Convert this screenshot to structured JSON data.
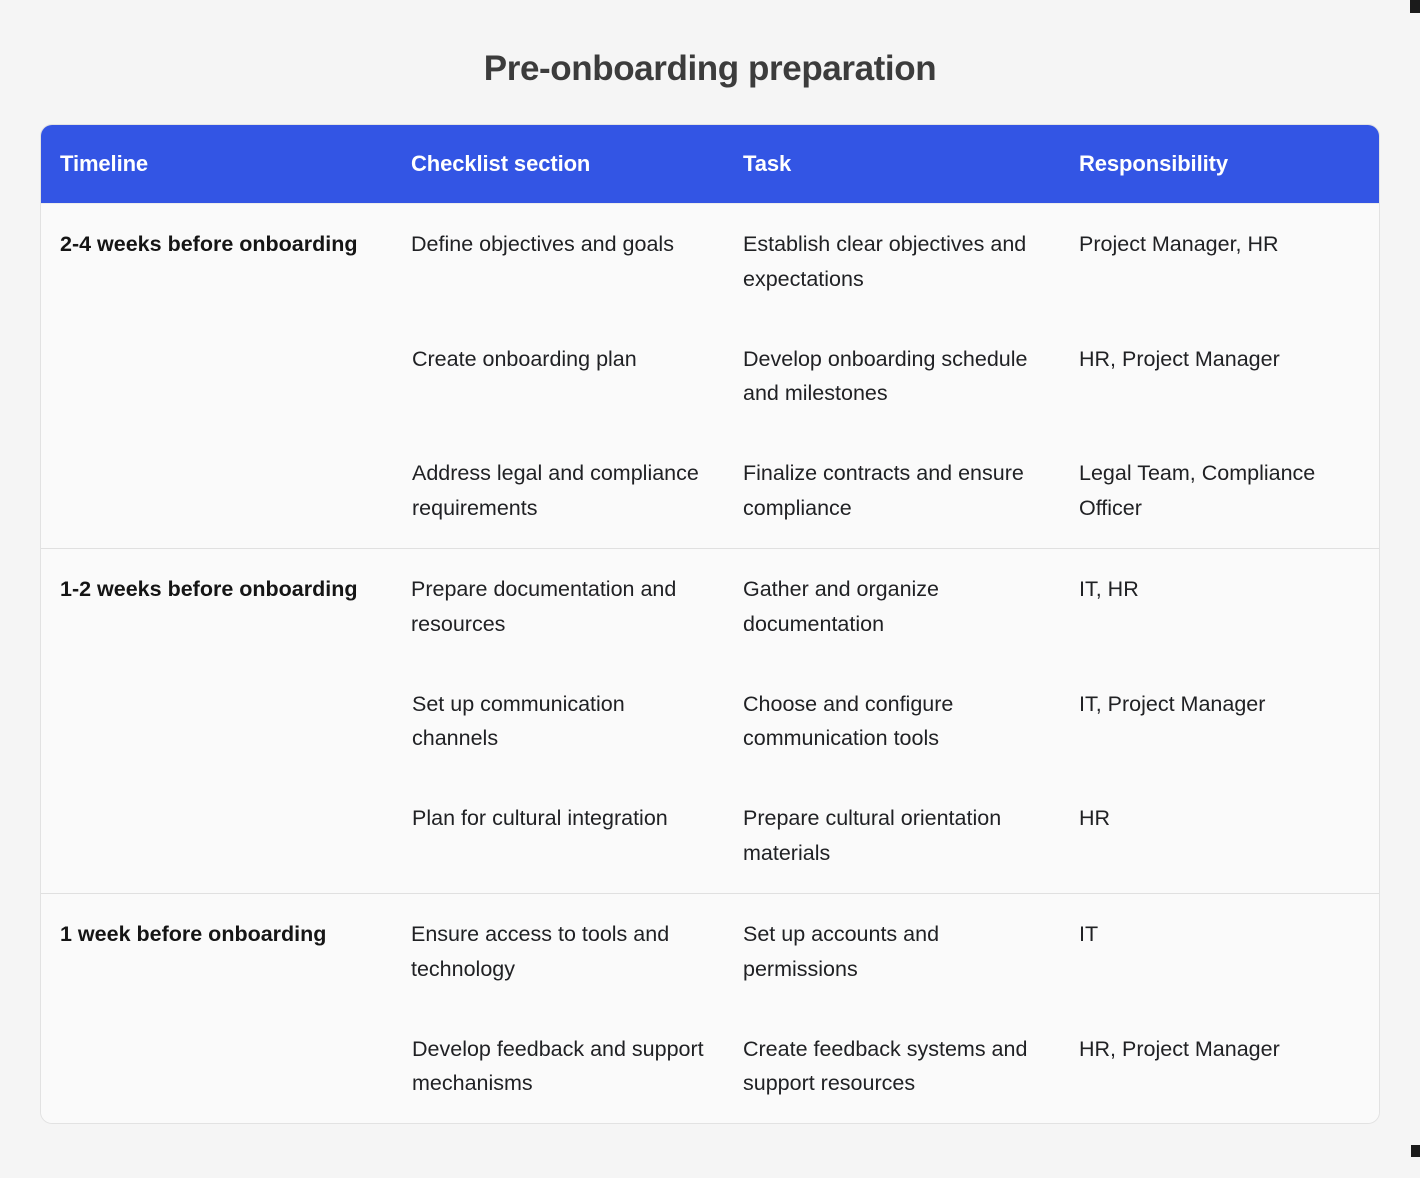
{
  "page": {
    "title": "Pre-onboarding preparation",
    "background_color": "#f5f5f5",
    "accent_color": "#3355e4",
    "card_background": "#fafafa",
    "header_text_color": "#ffffff",
    "body_text_color": "#202124"
  },
  "table": {
    "columns": [
      {
        "key": "timeline",
        "label": "Timeline"
      },
      {
        "key": "checklist",
        "label": "Checklist section"
      },
      {
        "key": "task",
        "label": "Task"
      },
      {
        "key": "responsibility",
        "label": "Responsibility"
      }
    ],
    "groups": [
      {
        "timeline": "2-4 weeks before onboarding",
        "rows": [
          {
            "checklist": "Define objectives and goals",
            "task": "Establish clear objectives and expectations",
            "responsibility": "Project Manager, HR"
          },
          {
            "checklist": "Create onboarding plan",
            "task": "Develop onboarding schedule and milestones",
            "responsibility": "HR, Project Manager"
          },
          {
            "checklist": "Address legal and compliance requirements",
            "task": "Finalize contracts and ensure compliance",
            "responsibility": "Legal Team, Compliance Officer"
          }
        ]
      },
      {
        "timeline": "1-2 weeks before onboarding",
        "rows": [
          {
            "checklist": "Prepare documentation and resources",
            "task": "Gather and organize documentation",
            "responsibility": "IT, HR"
          },
          {
            "checklist": "Set up communication channels",
            "task": "Choose and configure communication tools",
            "responsibility": "IT, Project Manager"
          },
          {
            "checklist": "Plan for cultural integration",
            "task": "Prepare cultural orientation materials",
            "responsibility": "HR"
          }
        ]
      },
      {
        "timeline": "1 week before onboarding",
        "rows": [
          {
            "checklist": "Ensure access to tools and technology",
            "task": "Set up accounts and permissions",
            "responsibility": "IT"
          },
          {
            "checklist": "Develop feedback and support mechanisms",
            "task": "Create feedback systems and support resources",
            "responsibility": "HR, Project Manager"
          }
        ]
      }
    ]
  }
}
